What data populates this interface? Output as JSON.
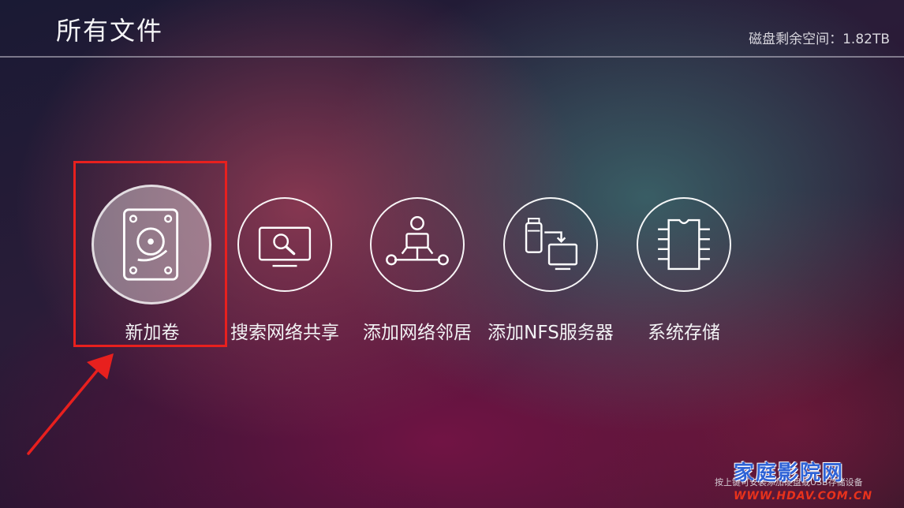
{
  "header": {
    "title": "所有文件",
    "disk_space": "磁盘剩余空间：1.82TB"
  },
  "items": [
    {
      "label": "新加卷",
      "icon": "hard-disk-icon",
      "selected": true
    },
    {
      "label": "搜索网络共享",
      "icon": "search-monitor-icon",
      "selected": false
    },
    {
      "label": "添加网络邻居",
      "icon": "network-user-icon",
      "selected": false
    },
    {
      "label": "添加NFS服务器",
      "icon": "usb-to-monitor-icon",
      "selected": false
    },
    {
      "label": "系统存储",
      "icon": "memory-chip-icon",
      "selected": false
    }
  ],
  "footer": {
    "hint": "按上键可安装添加硬盘或USB存储设备"
  },
  "annotation": {
    "highlight_color": "#e8201e"
  },
  "watermark": {
    "name": "家庭影院网",
    "url": "WWW.HDAV.COM.CN"
  }
}
